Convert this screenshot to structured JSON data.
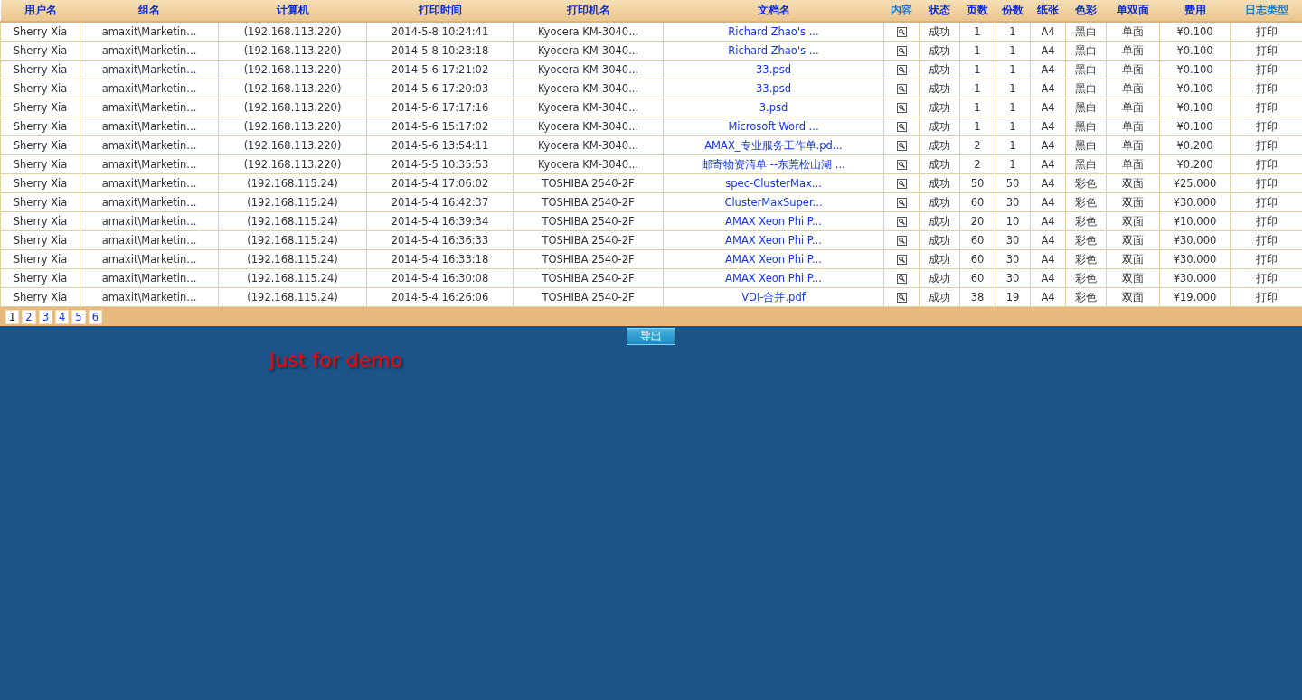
{
  "table": {
    "columns": [
      {
        "label": "用户名",
        "kind": "text",
        "highlighted": false
      },
      {
        "label": "组名",
        "kind": "text",
        "highlighted": false
      },
      {
        "label": "计算机",
        "kind": "text",
        "highlighted": false
      },
      {
        "label": "打印时间",
        "kind": "text",
        "highlighted": false
      },
      {
        "label": "打印机名",
        "kind": "text",
        "highlighted": false
      },
      {
        "label": "文档名",
        "kind": "link",
        "highlighted": false
      },
      {
        "label": "内容",
        "kind": "icon",
        "highlighted": true
      },
      {
        "label": "状态",
        "kind": "text",
        "highlighted": false
      },
      {
        "label": "页数",
        "kind": "text",
        "highlighted": false
      },
      {
        "label": "份数",
        "kind": "text",
        "highlighted": false
      },
      {
        "label": "纸张",
        "kind": "text",
        "highlighted": false
      },
      {
        "label": "色彩",
        "kind": "text",
        "highlighted": false
      },
      {
        "label": "单双面",
        "kind": "text",
        "highlighted": false
      },
      {
        "label": "费用",
        "kind": "text",
        "highlighted": false
      },
      {
        "label": "日志类型",
        "kind": "text",
        "highlighted": true
      }
    ],
    "rows": [
      [
        "Sherry Xia",
        "amaxit\\Marketin...",
        "(192.168.113.220)",
        "2014-5-8 10:24:41",
        "Kyocera KM-3040...",
        "Richard Zhao's ...",
        "",
        "成功",
        "1",
        "1",
        "A4",
        "黑白",
        "单面",
        "¥0.100",
        "打印"
      ],
      [
        "Sherry Xia",
        "amaxit\\Marketin...",
        "(192.168.113.220)",
        "2014-5-8 10:23:18",
        "Kyocera KM-3040...",
        "Richard Zhao's ...",
        "",
        "成功",
        "1",
        "1",
        "A4",
        "黑白",
        "单面",
        "¥0.100",
        "打印"
      ],
      [
        "Sherry Xia",
        "amaxit\\Marketin...",
        "(192.168.113.220)",
        "2014-5-6 17:21:02",
        "Kyocera KM-3040...",
        "33.psd",
        "",
        "成功",
        "1",
        "1",
        "A4",
        "黑白",
        "单面",
        "¥0.100",
        "打印"
      ],
      [
        "Sherry Xia",
        "amaxit\\Marketin...",
        "(192.168.113.220)",
        "2014-5-6 17:20:03",
        "Kyocera KM-3040...",
        "33.psd",
        "",
        "成功",
        "1",
        "1",
        "A4",
        "黑白",
        "单面",
        "¥0.100",
        "打印"
      ],
      [
        "Sherry Xia",
        "amaxit\\Marketin...",
        "(192.168.113.220)",
        "2014-5-6 17:17:16",
        "Kyocera KM-3040...",
        "3.psd",
        "",
        "成功",
        "1",
        "1",
        "A4",
        "黑白",
        "单面",
        "¥0.100",
        "打印"
      ],
      [
        "Sherry Xia",
        "amaxit\\Marketin...",
        "(192.168.113.220)",
        "2014-5-6 15:17:02",
        "Kyocera KM-3040...",
        "Microsoft Word ...",
        "",
        "成功",
        "1",
        "1",
        "A4",
        "黑白",
        "单面",
        "¥0.100",
        "打印"
      ],
      [
        "Sherry Xia",
        "amaxit\\Marketin...",
        "(192.168.113.220)",
        "2014-5-6 13:54:11",
        "Kyocera KM-3040...",
        "AMAX_专业服务工作单.pd...",
        "",
        "成功",
        "2",
        "1",
        "A4",
        "黑白",
        "单面",
        "¥0.200",
        "打印"
      ],
      [
        "Sherry Xia",
        "amaxit\\Marketin...",
        "(192.168.113.220)",
        "2014-5-5 10:35:53",
        "Kyocera KM-3040...",
        "邮寄物资清单 --东莞松山湖 ...",
        "",
        "成功",
        "2",
        "1",
        "A4",
        "黑白",
        "单面",
        "¥0.200",
        "打印"
      ],
      [
        "Sherry Xia",
        "amaxit\\Marketin...",
        "(192.168.115.24)",
        "2014-5-4 17:06:02",
        "TOSHIBA 2540-2F",
        "spec-ClusterMax...",
        "",
        "成功",
        "50",
        "50",
        "A4",
        "彩色",
        "双面",
        "¥25.000",
        "打印"
      ],
      [
        "Sherry Xia",
        "amaxit\\Marketin...",
        "(192.168.115.24)",
        "2014-5-4 16:42:37",
        "TOSHIBA 2540-2F",
        "ClusterMaxSuper...",
        "",
        "成功",
        "60",
        "30",
        "A4",
        "彩色",
        "双面",
        "¥30.000",
        "打印"
      ],
      [
        "Sherry Xia",
        "amaxit\\Marketin...",
        "(192.168.115.24)",
        "2014-5-4 16:39:34",
        "TOSHIBA 2540-2F",
        "AMAX Xeon Phi P...",
        "",
        "成功",
        "20",
        "10",
        "A4",
        "彩色",
        "双面",
        "¥10.000",
        "打印"
      ],
      [
        "Sherry Xia",
        "amaxit\\Marketin...",
        "(192.168.115.24)",
        "2014-5-4 16:36:33",
        "TOSHIBA 2540-2F",
        "AMAX Xeon Phi P...",
        "",
        "成功",
        "60",
        "30",
        "A4",
        "彩色",
        "双面",
        "¥30.000",
        "打印"
      ],
      [
        "Sherry Xia",
        "amaxit\\Marketin...",
        "(192.168.115.24)",
        "2014-5-4 16:33:18",
        "TOSHIBA 2540-2F",
        "AMAX Xeon Phi P...",
        "",
        "成功",
        "60",
        "30",
        "A4",
        "彩色",
        "双面",
        "¥30.000",
        "打印"
      ],
      [
        "Sherry Xia",
        "amaxit\\Marketin...",
        "(192.168.115.24)",
        "2014-5-4 16:30:08",
        "TOSHIBA 2540-2F",
        "AMAX Xeon Phi P...",
        "",
        "成功",
        "60",
        "30",
        "A4",
        "彩色",
        "双面",
        "¥30.000",
        "打印"
      ],
      [
        "Sherry Xia",
        "amaxit\\Marketin...",
        "(192.168.115.24)",
        "2014-5-4 16:26:06",
        "TOSHIBA 2540-2F",
        "VDI-合并.pdf",
        "",
        "成功",
        "38",
        "19",
        "A4",
        "彩色",
        "双面",
        "¥19.000",
        "打印"
      ]
    ]
  },
  "pagination": [
    {
      "label": "1",
      "selected": true
    },
    {
      "label": "2",
      "selected": false
    },
    {
      "label": "3",
      "selected": false
    },
    {
      "label": "4",
      "selected": false
    },
    {
      "label": "5",
      "selected": false
    },
    {
      "label": "6",
      "selected": false
    }
  ],
  "export_button": "导出",
  "demo_note": "Just for demo"
}
